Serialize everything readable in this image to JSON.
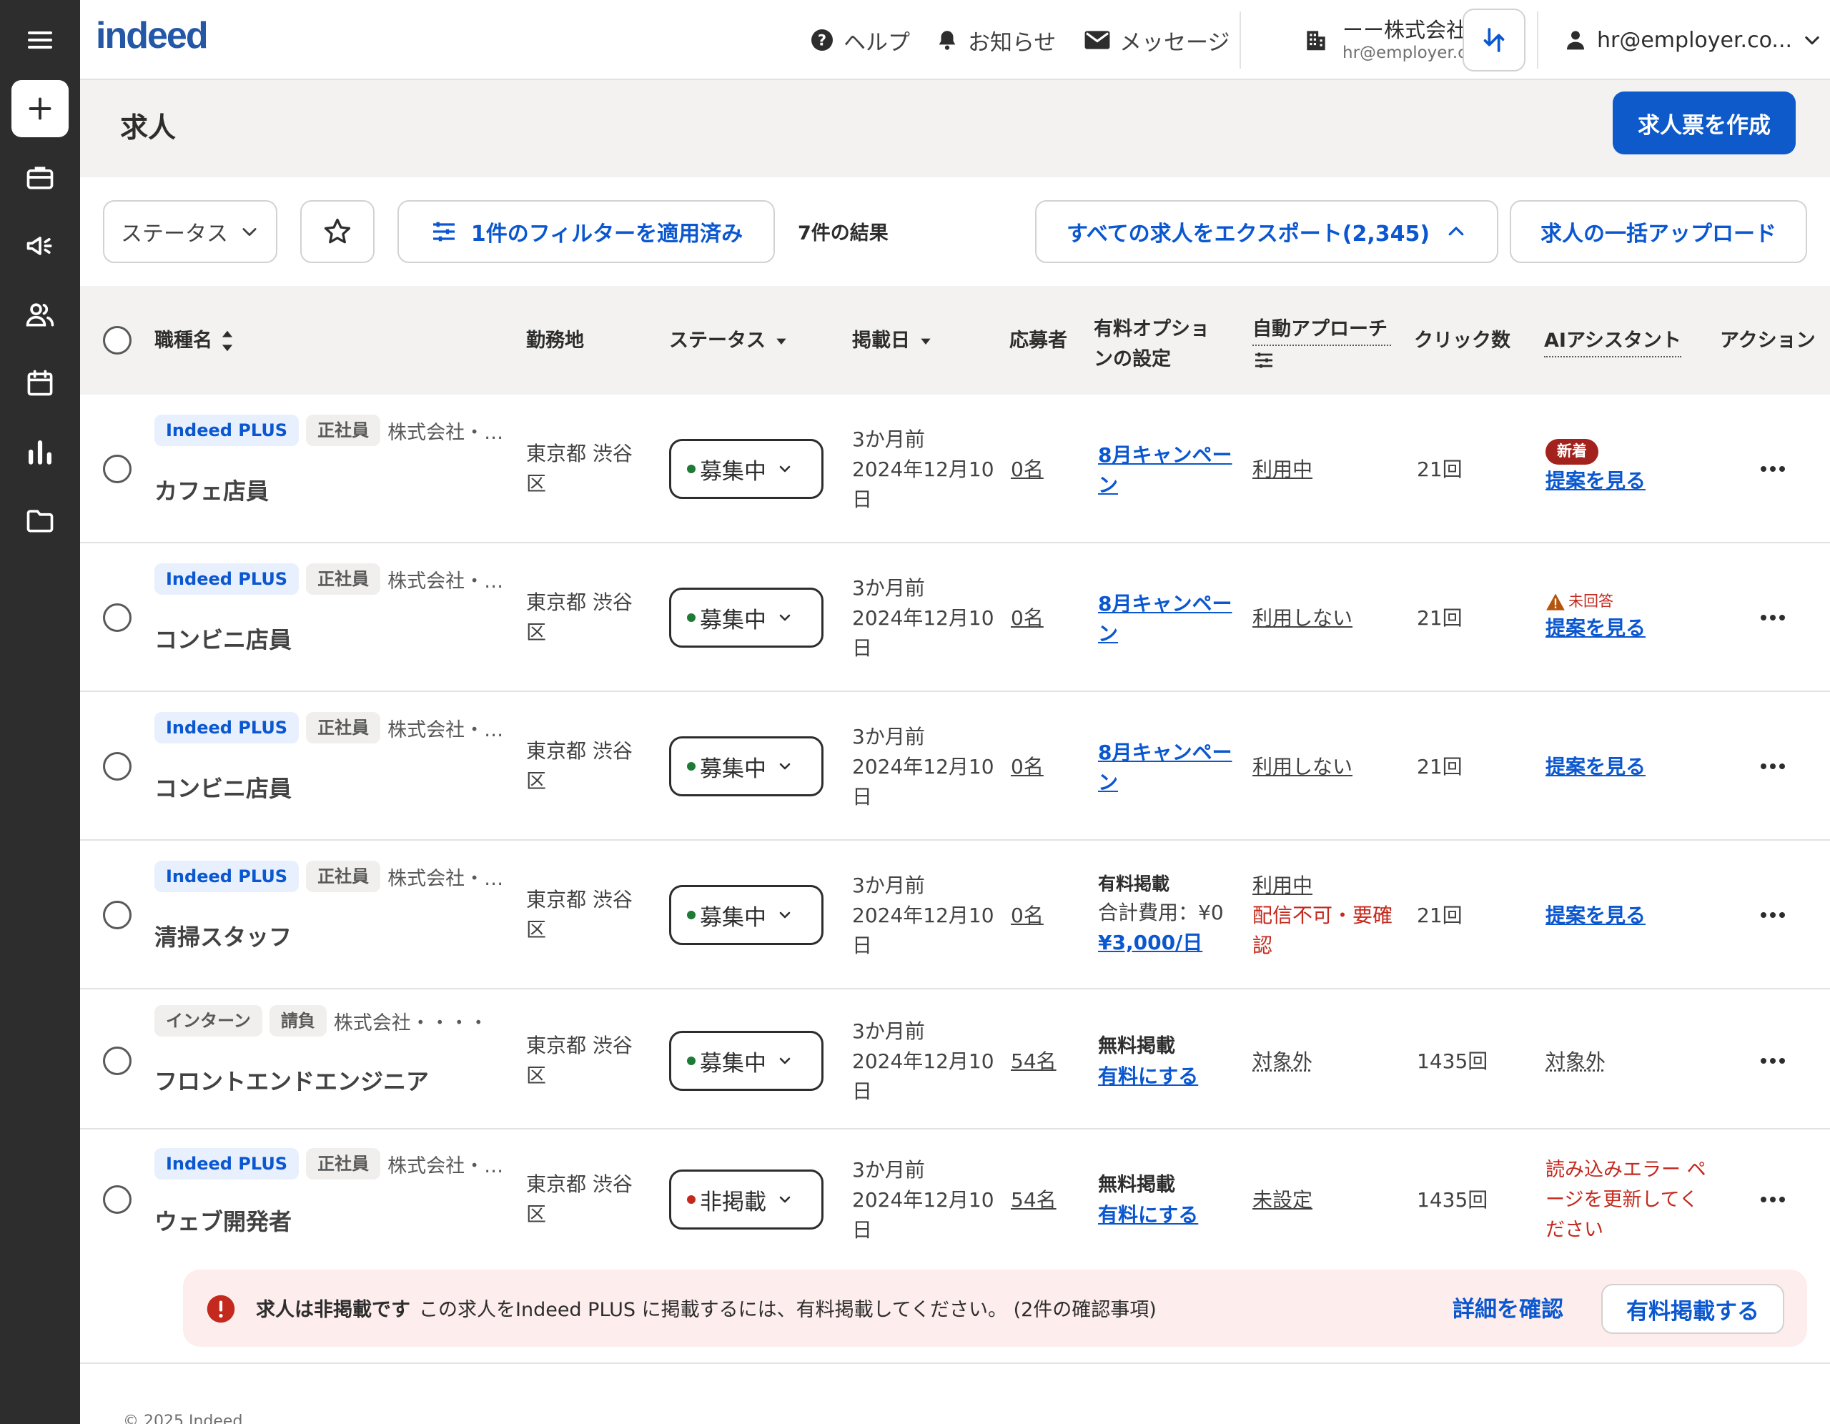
{
  "topbar": {
    "logo": "indeed",
    "help": "ヘルプ",
    "notifications": "お知らせ",
    "messages": "メッセージ",
    "company_name": "ーー株式会社",
    "company_email": "hr@employer.com",
    "account_email": "hr@employer.co..."
  },
  "page": {
    "title": "求人",
    "create_button": "求人票を作成"
  },
  "filters": {
    "status_label": "ステータス",
    "applied_filters": "1件のフィルターを適用済み",
    "results": "7件の結果",
    "export": "すべての求人をエクスポート(2,345)",
    "bulk_upload": "求人の一括アップロード"
  },
  "table": {
    "headers": {
      "job_title": "職種名",
      "location": "勤務地",
      "status": "ステータス",
      "posted": "掲載日",
      "applicants": "応募者",
      "paid_option_1": "有料オプショ",
      "paid_option_2": "ンの設定",
      "auto_approach": "自動アプローチ",
      "clicks": "クリック数",
      "ai_assistant": "AIアシスタント",
      "actions": "アクション"
    },
    "rows": [
      {
        "tag1": "Indeed PLUS",
        "tag2": "正社員",
        "company": "株式会社・・・・",
        "title": "カフェ店員",
        "location": "東京都 渋谷区",
        "status": "募集中",
        "date_relative": "3か月前",
        "date_full": "2024年12月10日",
        "applicants": "0名",
        "option": "8月キャンペーン",
        "auto": "利用中",
        "clicks": "21回",
        "ai_badge": "新着",
        "ai_link": "提案を見る"
      },
      {
        "tag1": "Indeed PLUS",
        "tag2": "正社員",
        "company": "株式会社・・・・",
        "title": "コンビニ店員",
        "location": "東京都 渋谷区",
        "status": "募集中",
        "date_relative": "3か月前",
        "date_full": "2024年12月10日",
        "applicants": "0名",
        "option": "8月キャンペーン",
        "auto": "利用しない",
        "clicks": "21回",
        "ai_warning": "未回答",
        "ai_link": "提案を見る"
      },
      {
        "tag1": "Indeed PLUS",
        "tag2": "正社員",
        "company": "株式会社・・・・",
        "title": "コンビニ店員",
        "location": "東京都 渋谷区",
        "status": "募集中",
        "date_relative": "3か月前",
        "date_full": "2024年12月10日",
        "applicants": "0名",
        "option": "8月キャンペーン",
        "auto": "利用しない",
        "clicks": "21回",
        "ai_link": "提案を見る"
      },
      {
        "tag1": "Indeed PLUS",
        "tag2": "正社員",
        "company": "株式会社・・・・",
        "title": "清掃スタッフ",
        "location": "東京都 渋谷区",
        "status": "募集中",
        "date_relative": "3か月前",
        "date_full": "2024年12月10日",
        "applicants": "0名",
        "option_label": "有料掲載",
        "option_cost": "合計費用：¥0",
        "option_link": "¥3,000/日",
        "auto": "利用中",
        "auto_warning": "配信不可・要確認",
        "clicks": "21回",
        "ai_link": "提案を見る"
      },
      {
        "tag1": "インターン",
        "tag2": "請負",
        "company": "株式会社・・・・",
        "title": "フロントエンドエンジニア",
        "location": "東京都 渋谷区",
        "status": "募集中",
        "date_relative": "3か月前",
        "date_full": "2024年12月10日",
        "applicants": "54名",
        "option_label": "無料掲載",
        "option_link": "有料にする",
        "auto": "対象外",
        "clicks": "1435回",
        "ai_text": "対象外"
      },
      {
        "tag1": "Indeed PLUS",
        "tag2": "正社員",
        "company": "株式会社・・・・",
        "title": "ウェブ開発者",
        "location": "東京都 渋谷区",
        "status": "非掲載",
        "date_relative": "3か月前",
        "date_full": "2024年12月10日",
        "applicants": "54名",
        "option_label": "無料掲載",
        "option_link": "有料にする",
        "auto": "未設定",
        "clicks": "1435回",
        "ai_error": "読み込みエラー ページを更新してください"
      }
    ]
  },
  "alert": {
    "title": "求人は非掲載です",
    "message": "この求人をIndeed PLUS に掲載するには、有料掲載してください。 (2件の確認事項)",
    "details_link": "詳細を確認",
    "action_button": "有料掲載する"
  },
  "footer": {
    "copyright": "© 2025 Indeed"
  },
  "colors": {
    "accent": "#0b57d0",
    "primary_button": "#0f5acb",
    "sidebar": "#2d2d2d",
    "status_active": "#1e7a34",
    "status_inactive": "#c4291d",
    "alert_bg": "#fdeded"
  },
  "icons": {
    "sidebar": [
      "menu-icon",
      "plus-icon",
      "briefcase-icon",
      "megaphone-icon",
      "people-icon",
      "calendar-icon",
      "chart-icon",
      "folder-icon"
    ],
    "topbar": [
      "help-icon",
      "bell-icon",
      "mail-icon",
      "building-icon",
      "switch-arrows-icon",
      "person-icon",
      "chevron-down-icon"
    ]
  }
}
